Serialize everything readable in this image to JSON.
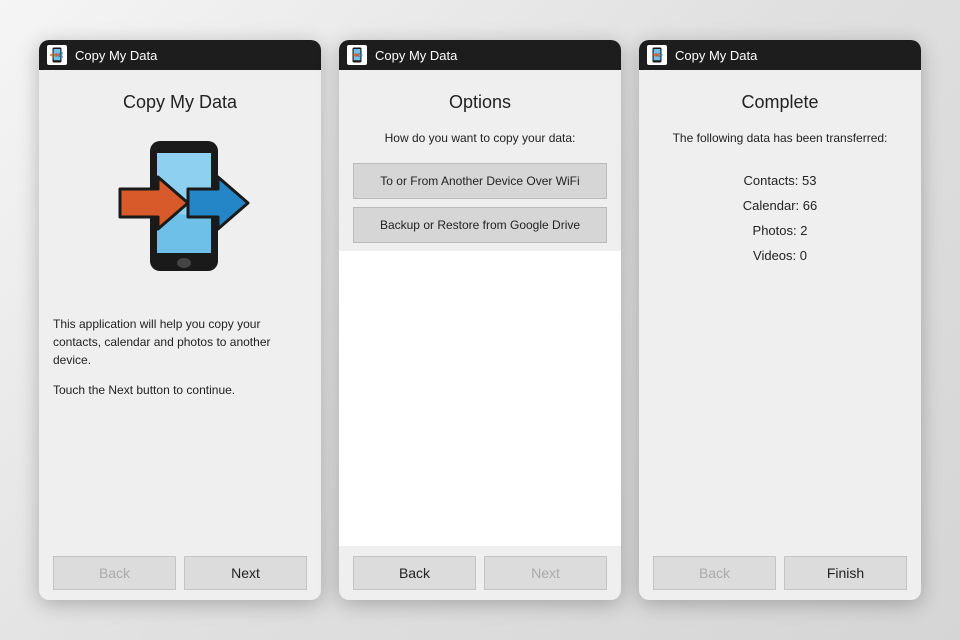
{
  "app_name": "Copy My Data",
  "screen1": {
    "title": "Copy My Data",
    "description1": "This application will help you copy your contacts, calendar and photos to another device.",
    "description2": "Touch the Next button to continue.",
    "back_label": "Back",
    "next_label": "Next",
    "back_enabled": false,
    "next_enabled": true
  },
  "screen2": {
    "title": "Options",
    "subtitle": "How do you want to copy your data:",
    "options": [
      "To or From Another Device Over WiFi",
      "Backup or Restore from Google Drive"
    ],
    "back_label": "Back",
    "next_label": "Next",
    "back_enabled": true,
    "next_enabled": false
  },
  "screen3": {
    "title": "Complete",
    "subtitle": "The following data has been transferred:",
    "results": {
      "contacts_label": "Contacts: 53",
      "calendar_label": "Calendar: 66",
      "photos_label": "Photos: 2",
      "videos_label": "Videos: 0",
      "contacts": 53,
      "calendar": 66,
      "photos": 2,
      "videos": 0
    },
    "back_label": "Back",
    "finish_label": "Finish",
    "back_enabled": false,
    "finish_enabled": true
  }
}
